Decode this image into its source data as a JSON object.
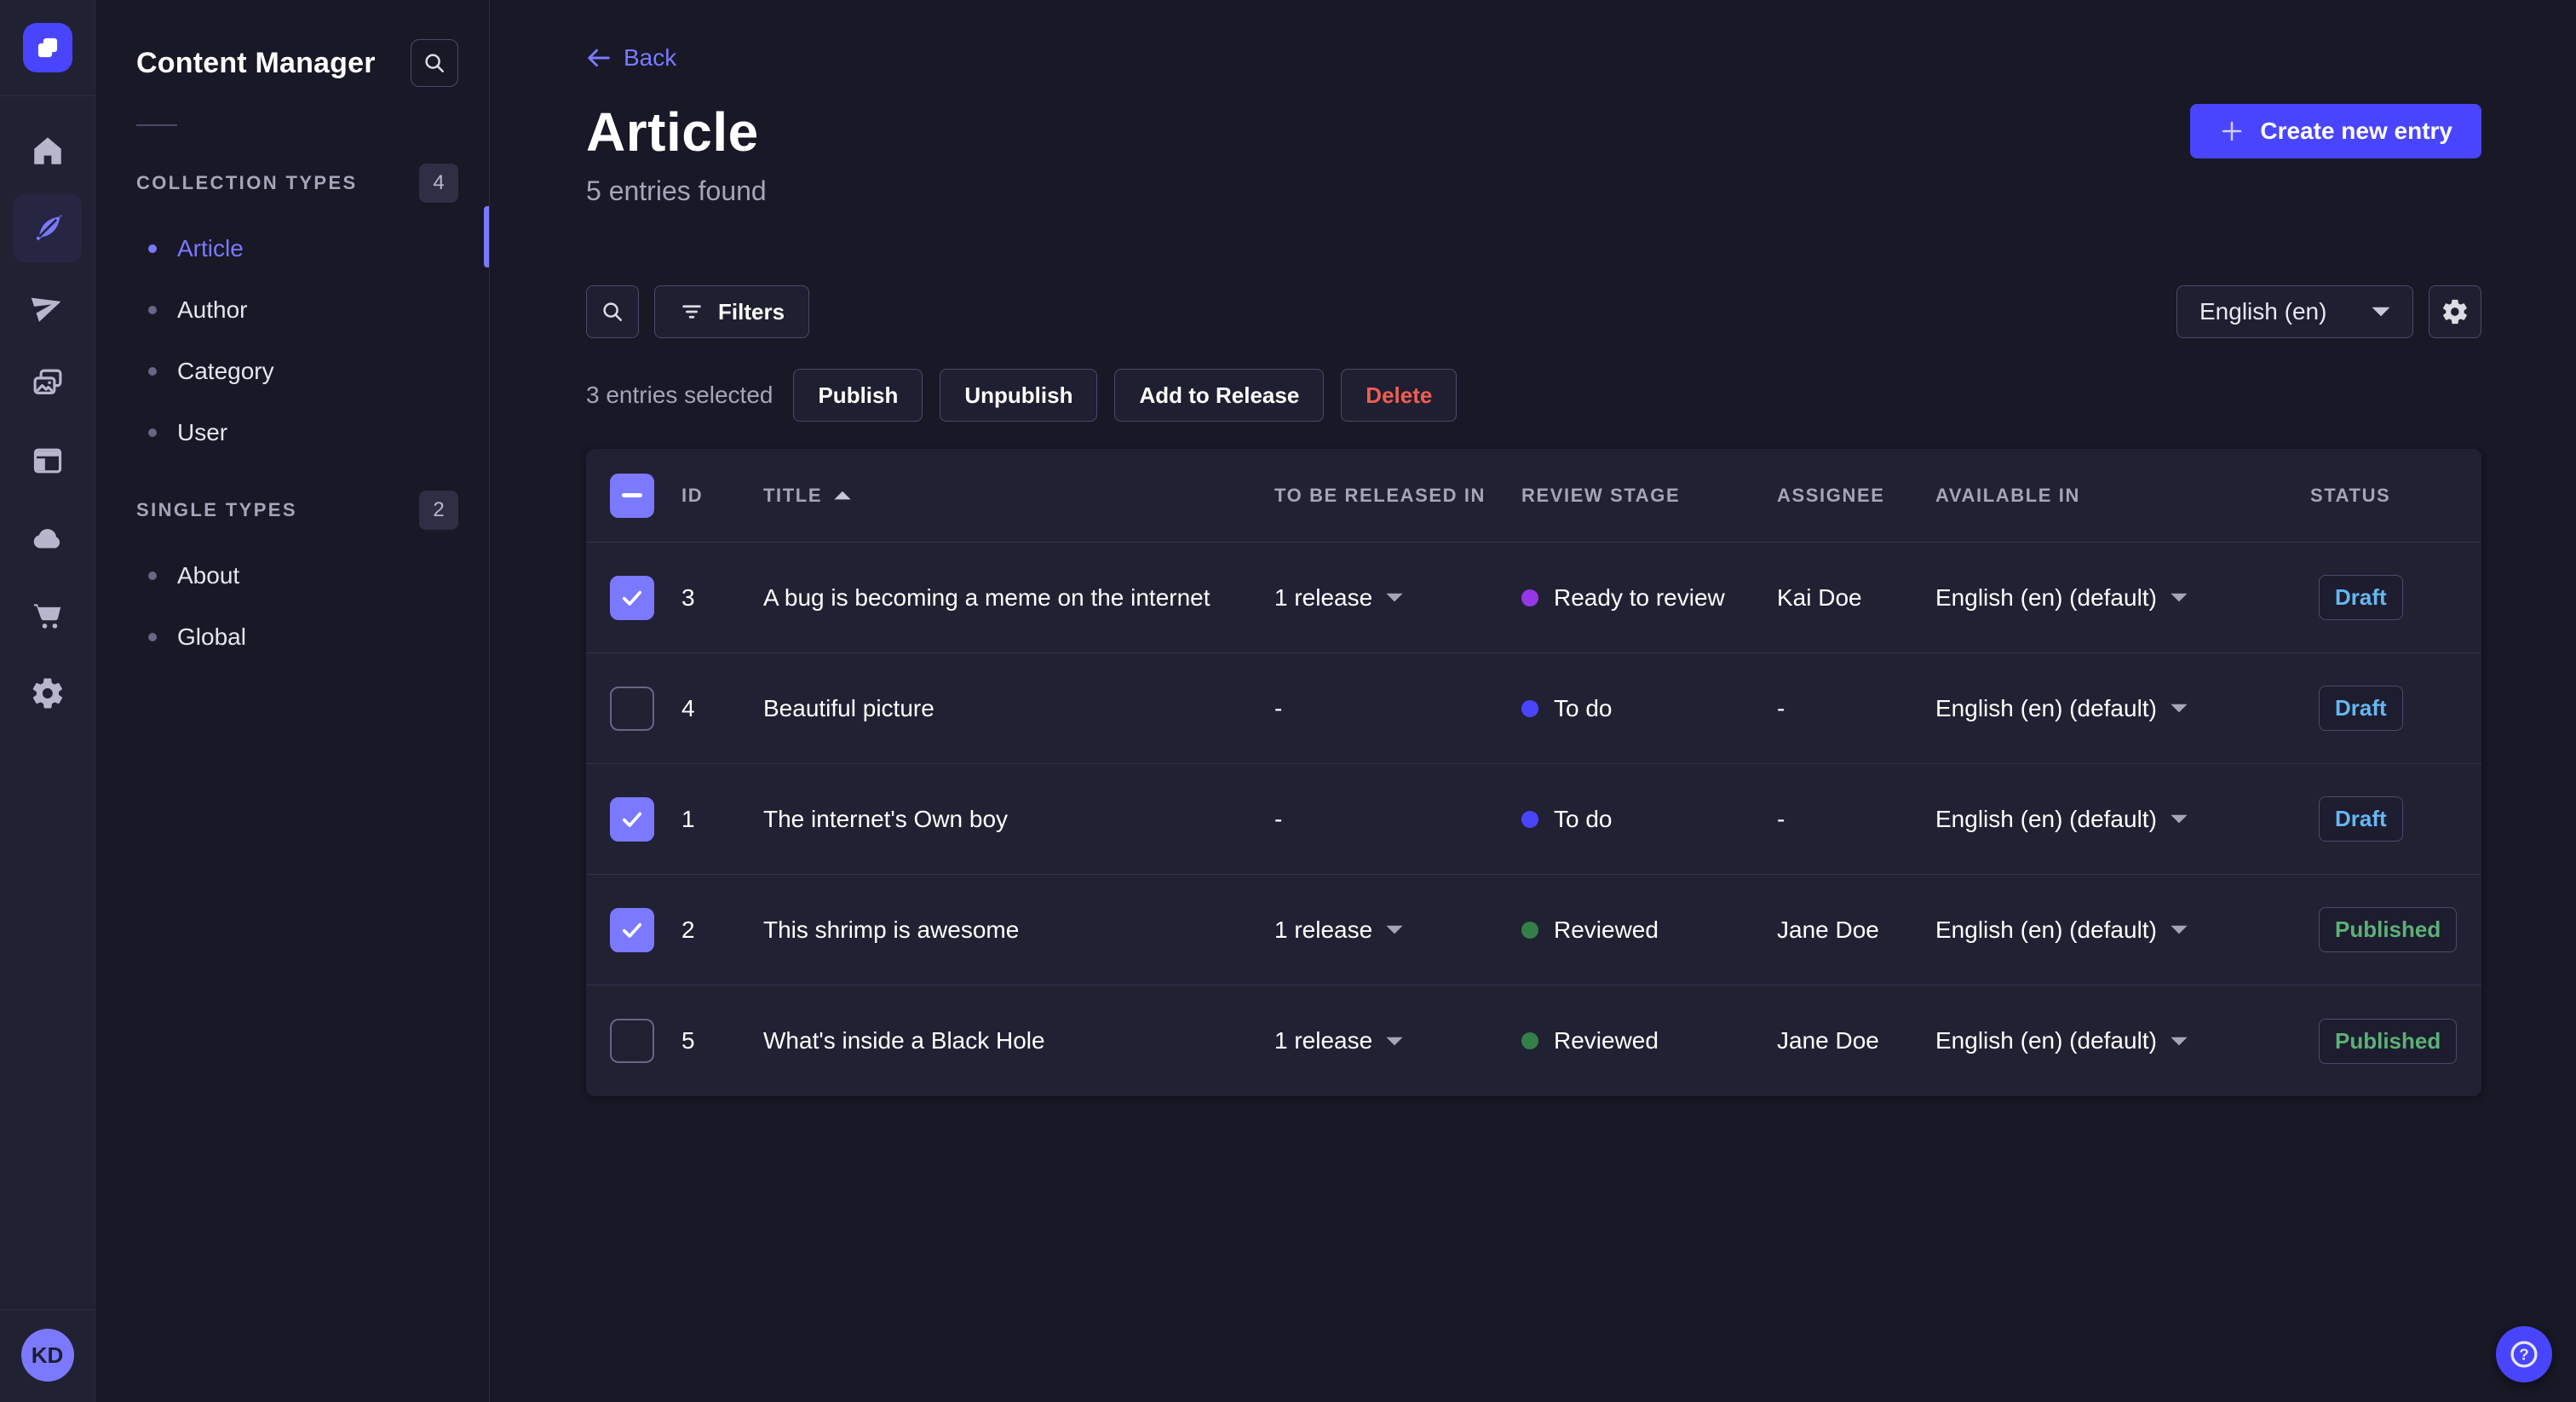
{
  "colors": {
    "brand": "#4945ff",
    "accent": "#7b79ff",
    "draft_text": "#66b7f1",
    "published_text": "#5cb176",
    "delete_text": "#ee5e52",
    "stage_to_do": "#4945ff",
    "stage_ready_to_review": "#9736e8",
    "stage_reviewed": "#328048"
  },
  "main_nav": {
    "items": [
      {
        "icon": "home-icon"
      },
      {
        "icon": "content-manager-icon",
        "active": true
      },
      {
        "icon": "releases-icon"
      },
      {
        "icon": "media-library-icon"
      },
      {
        "icon": "content-type-builder-icon"
      },
      {
        "icon": "cloud-icon"
      },
      {
        "icon": "marketplace-icon"
      },
      {
        "icon": "settings-icon"
      }
    ],
    "avatar_initials": "KD"
  },
  "subnav": {
    "title": "Content Manager",
    "sections": [
      {
        "label": "COLLECTION TYPES",
        "count": "4",
        "items": [
          {
            "label": "Article",
            "active": true
          },
          {
            "label": "Author"
          },
          {
            "label": "Category"
          },
          {
            "label": "User"
          }
        ]
      },
      {
        "label": "SINGLE TYPES",
        "count": "2",
        "items": [
          {
            "label": "About"
          },
          {
            "label": "Global"
          }
        ]
      }
    ]
  },
  "header": {
    "back": "Back",
    "title": "Article",
    "subtitle": "5 entries found",
    "create": "Create new entry"
  },
  "toolbar": {
    "filters": "Filters",
    "locale": "English (en)"
  },
  "selection": {
    "count_text": "3 entries selected",
    "publish": "Publish",
    "unpublish": "Unpublish",
    "add_to_release": "Add to Release",
    "delete": "Delete"
  },
  "table": {
    "headers": {
      "id": "ID",
      "title": "TITLE",
      "release": "TO BE RELEASED IN",
      "review": "REVIEW STAGE",
      "assignee": "ASSIGNEE",
      "available": "AVAILABLE IN",
      "status": "STATUS"
    },
    "sort": {
      "column": "TITLE",
      "direction": "ascending"
    },
    "header_checkbox": "indeterminate",
    "rows": [
      {
        "selected": true,
        "id": "3",
        "title": "A bug is becoming a meme on the internet",
        "release": "1 release",
        "review_stage": "Ready to review",
        "review_color": "#9736e8",
        "assignee": "Kai Doe",
        "available_in": "English (en) (default)",
        "status": "Draft"
      },
      {
        "selected": false,
        "id": "4",
        "title": "Beautiful picture",
        "release": "-",
        "review_stage": "To do",
        "review_color": "#4945ff",
        "assignee": "-",
        "available_in": "English (en) (default)",
        "status": "Draft"
      },
      {
        "selected": true,
        "id": "1",
        "title": "The internet's Own boy",
        "release": "-",
        "review_stage": "To do",
        "review_color": "#4945ff",
        "assignee": "-",
        "available_in": "English (en) (default)",
        "status": "Draft"
      },
      {
        "selected": true,
        "id": "2",
        "title": "This shrimp is awesome",
        "release": "1 release",
        "review_stage": "Reviewed",
        "review_color": "#328048",
        "assignee": "Jane Doe",
        "available_in": "English (en) (default)",
        "status": "Published"
      },
      {
        "selected": false,
        "id": "5",
        "title": "What's inside a Black Hole",
        "release": "1 release",
        "review_stage": "Reviewed",
        "review_color": "#328048",
        "assignee": "Jane Doe",
        "available_in": "English (en) (default)",
        "status": "Published"
      }
    ]
  }
}
